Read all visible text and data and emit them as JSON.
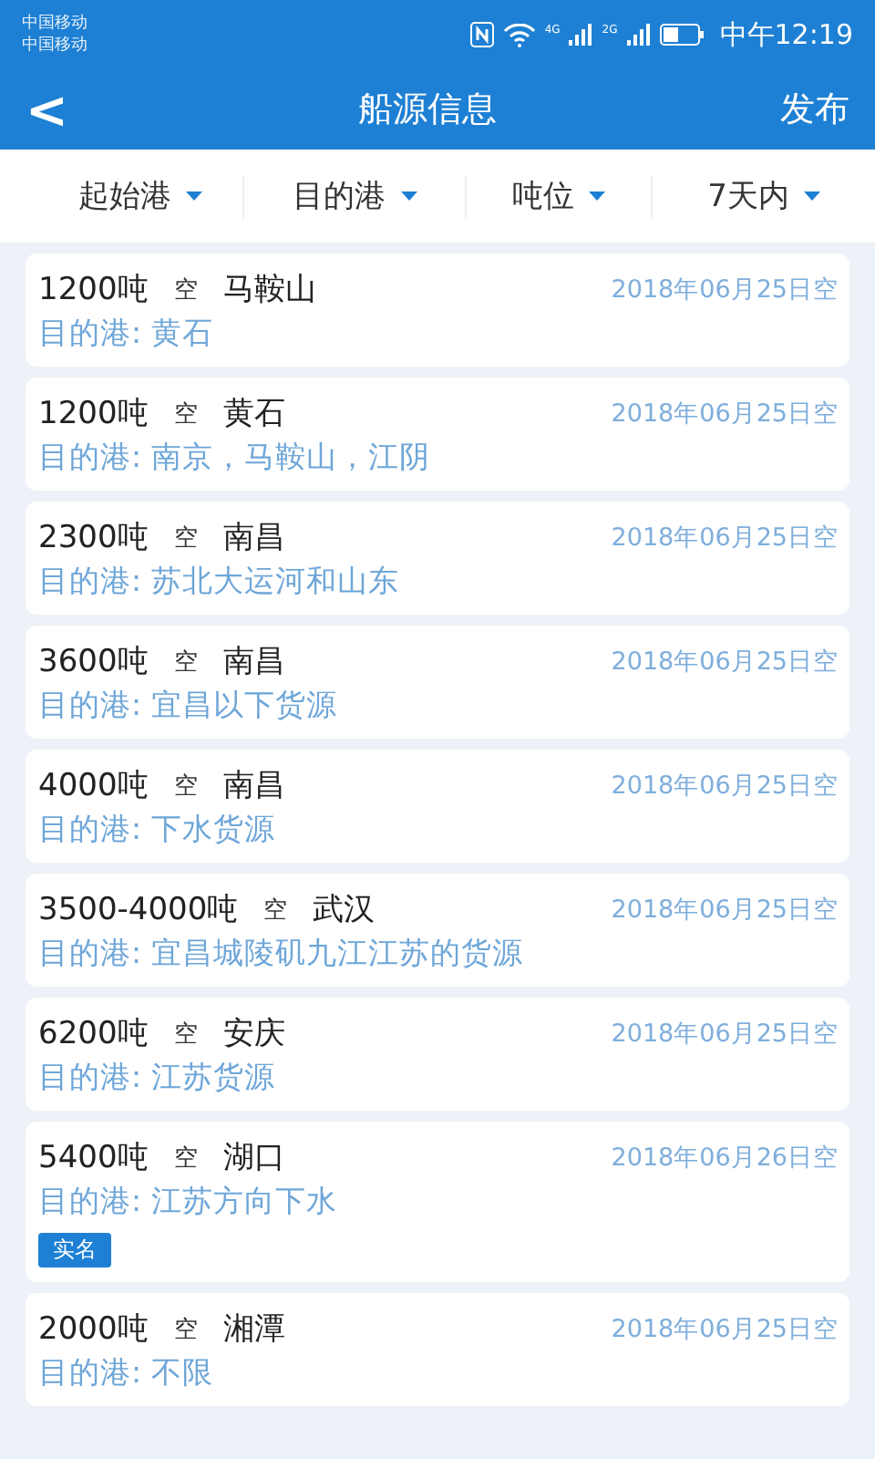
{
  "status_bar": {
    "carriers": [
      "中国移动",
      "中国移动"
    ],
    "networks": [
      "4G",
      "2G"
    ],
    "time": "中午12:19"
  },
  "header": {
    "back": "<",
    "title": "船源信息",
    "action": "发布"
  },
  "filters": [
    {
      "label": "起始港"
    },
    {
      "label": "目的港"
    },
    {
      "label": "吨位"
    },
    {
      "label": "7天内"
    }
  ],
  "ships": [
    {
      "tonnage": "1200吨",
      "status": "空",
      "port": "马鞍山",
      "date": "2018年06月25日空",
      "destination": "目的港: 黄石"
    },
    {
      "tonnage": "1200吨",
      "status": "空",
      "port": "黄石",
      "date": "2018年06月25日空",
      "destination": "目的港: 南京，马鞍山，江阴"
    },
    {
      "tonnage": "2300吨",
      "status": "空",
      "port": "南昌",
      "date": "2018年06月25日空",
      "destination": "目的港: 苏北大运河和山东"
    },
    {
      "tonnage": "3600吨",
      "status": "空",
      "port": "南昌",
      "date": "2018年06月25日空",
      "destination": "目的港: 宜昌以下货源"
    },
    {
      "tonnage": "4000吨",
      "status": "空",
      "port": "南昌",
      "date": "2018年06月25日空",
      "destination": "目的港: 下水货源"
    },
    {
      "tonnage": "3500-4000吨",
      "status": "空",
      "port": "武汉",
      "date": "2018年06月25日空",
      "destination": "目的港: 宜昌城陵矶九江江苏的货源"
    },
    {
      "tonnage": "6200吨",
      "status": "空",
      "port": "安庆",
      "date": "2018年06月25日空",
      "destination": "目的港: 江苏货源"
    },
    {
      "tonnage": "5400吨",
      "status": "空",
      "port": "湖口",
      "date": "2018年06月26日空",
      "destination": "目的港: 江苏方向下水",
      "badge": "实名"
    },
    {
      "tonnage": "2000吨",
      "status": "空",
      "port": "湘潭",
      "date": "2018年06月25日空",
      "destination": "目的港: 不限"
    }
  ]
}
